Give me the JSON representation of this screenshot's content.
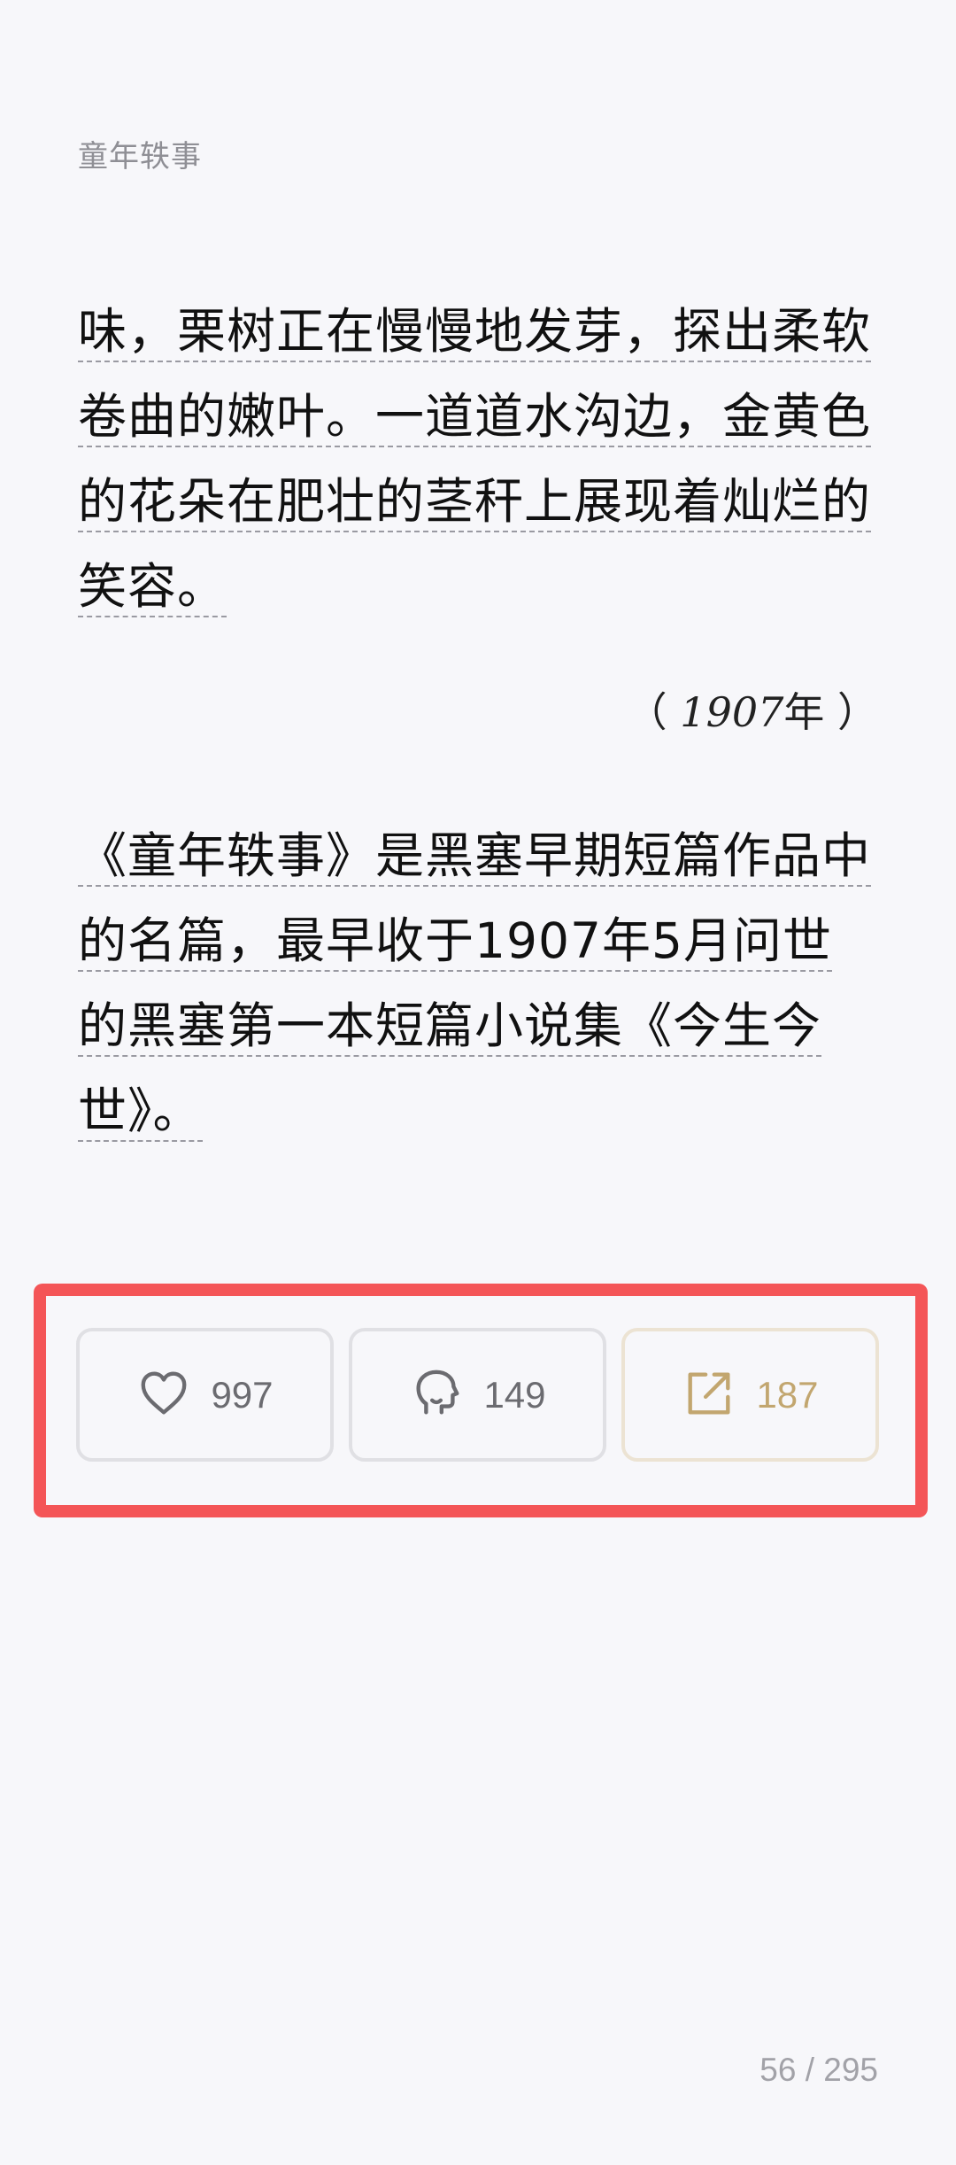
{
  "header": {
    "book_title": "童年轶事"
  },
  "content": {
    "paragraph1_lines": [
      "味，栗树正在慢慢地发芽，探出柔软",
      "卷曲的嫩叶。一道道水沟边，金黄色",
      "的花朵在肥壮的茎秆上展现着灿烂的",
      "笑容。"
    ],
    "year_note": {
      "open": "（ ",
      "year": "1907",
      "suffix": "年 ）"
    },
    "paragraph2_lines": [
      "《童年轶事》是黑塞早期短篇作品中",
      "的名篇，最早收于1907年5月问世",
      "的黑塞第一本短篇小说集《今生今",
      "世》。"
    ]
  },
  "actions": {
    "like_count": "997",
    "comment_count": "149",
    "share_count": "187"
  },
  "footer": {
    "page_indicator": "56 / 295"
  },
  "colors": {
    "highlight_frame": "#f45557",
    "share_accent": "#c2a66f",
    "icon_gray": "#6b6b70"
  },
  "icons": {
    "like": "heart-icon",
    "comment": "comment-head-icon",
    "share": "share-external-icon"
  }
}
